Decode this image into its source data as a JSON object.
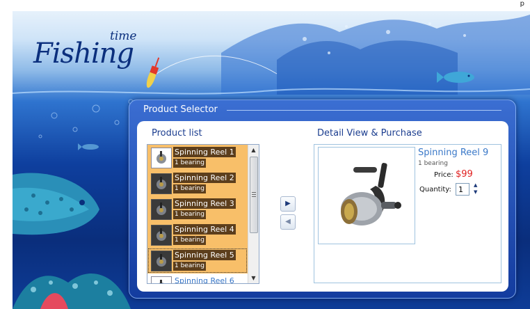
{
  "header": {
    "top_fragment": "p",
    "top_link": ""
  },
  "colors": {
    "selected_item": "#f8bf69",
    "label_bg": "#5c3e1c",
    "link_blue": "#3a78c8",
    "price_red": "#e02020"
  },
  "logo": {
    "word": "Fishing",
    "superscript": "time"
  },
  "panel": {
    "title": "Product Selector",
    "list_heading": "Product list",
    "detail_heading": "Detail View & Purchase"
  },
  "products": [
    {
      "name": "Spinning Reel 1",
      "detail": "1 bearing"
    },
    {
      "name": "Spinning Reel 2",
      "detail": "1 bearing"
    },
    {
      "name": "Spinning Reel 3",
      "detail": "1 bearing"
    },
    {
      "name": "Spinning Reel 4",
      "detail": "1 bearing"
    },
    {
      "name": "Spinning Reel 5",
      "detail": "1 bearing"
    },
    {
      "name": "Spinning Reel 6",
      "detail": ""
    }
  ],
  "controls": {
    "move_right": "▶",
    "move_left": "◀",
    "scroll_up": "▲",
    "scroll_down": "▼"
  },
  "detail": {
    "name": "Spinning Reel 9",
    "bearing": "1 bearing",
    "price_label": "Price:",
    "price": "$99",
    "quantity_label": "Quantity:",
    "quantity": "1",
    "spin_up": "▲",
    "spin_down": "▼"
  }
}
